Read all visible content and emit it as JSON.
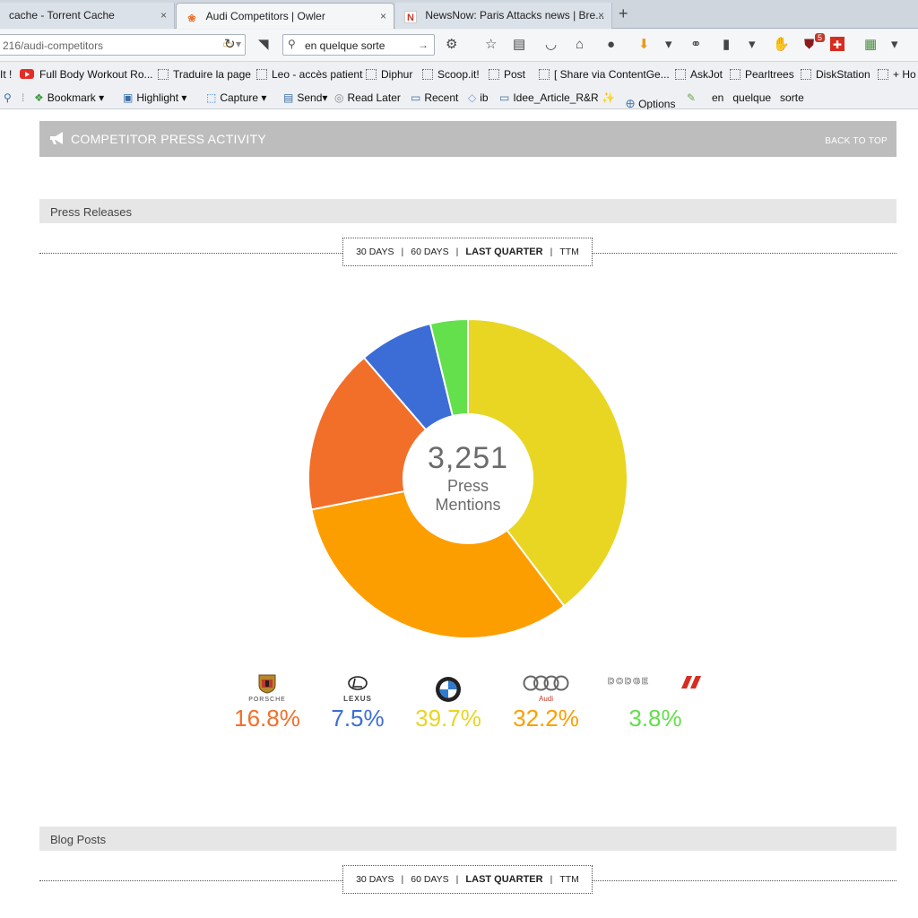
{
  "browser": {
    "tabs": [
      {
        "label": "cache - Torrent Cache",
        "active": false
      },
      {
        "label": "Audi Competitors | Owler",
        "active": true
      },
      {
        "label": "NewsNow: Paris Attacks news | Bre...",
        "active": false
      }
    ],
    "tab_close_glyph": "×",
    "new_tab_glyph": "+",
    "url": "216/audi-competitors",
    "search_value": "en quelque sorte",
    "notification_count": "5",
    "bookmarks": [
      "It !",
      "Full Body Workout Ro...",
      "Traduire la page",
      "Leo - accès patient",
      "Diphur",
      "Scoop.it!",
      "Post",
      "[ Share via ContentGe...",
      "AskJot",
      "Pearltrees",
      "DiskStation",
      "+ Ho"
    ],
    "toolbar2": {
      "bookmark": "Bookmark",
      "highlight": "Highlight",
      "capture": "Capture",
      "send": "Send",
      "read_later": "Read Later",
      "recent": "Recent",
      "ib": "ib",
      "idee": "Idee_Article_R&R",
      "options": "Options",
      "words": "en   quelque   sorte"
    }
  },
  "page": {
    "section_title": "COMPETITOR PRESS ACTIVITY",
    "back_to_top": "BACK TO TOP",
    "press_releases": "Press Releases",
    "blog_posts": "Blog Posts",
    "periods": [
      "30 DAYS",
      "60 DAYS",
      "LAST QUARTER",
      "TTM"
    ],
    "selected_period": "LAST QUARTER",
    "period_separator": "|",
    "total_value": "3,251",
    "total_label_1": "Press",
    "total_label_2": "Mentions"
  },
  "colors": {
    "bmw": "#e8d622",
    "audi": "#fd9e00",
    "porsche": "#f26f2a",
    "lexus": "#3c6dd6",
    "dodge": "#63e04b"
  },
  "chart_data": {
    "type": "pie",
    "donut": true,
    "title": "",
    "categories": [
      "BMW",
      "Audi",
      "Porsche",
      "Lexus",
      "Dodge"
    ],
    "values": [
      39.7,
      32.2,
      16.8,
      7.5,
      3.8
    ],
    "labels": [
      "39.7%",
      "32.2%",
      "16.8%",
      "7.5%",
      "3.8%"
    ],
    "center_value": 3251,
    "start_angle_deg": 0,
    "direction": "clockwise"
  },
  "legend": [
    {
      "key": "porsche",
      "brand": "PORSCHE",
      "pct": "16.8%"
    },
    {
      "key": "lexus",
      "brand": "LEXUS",
      "pct": "7.5%"
    },
    {
      "key": "bmw",
      "brand": "",
      "pct": "39.7%"
    },
    {
      "key": "audi",
      "brand": "Audi",
      "pct": "32.2%"
    },
    {
      "key": "dodge",
      "brand": "DODGE",
      "pct": "3.8%"
    }
  ]
}
